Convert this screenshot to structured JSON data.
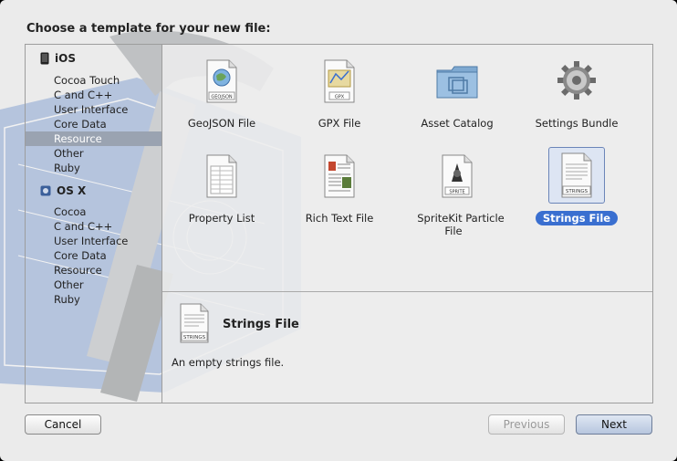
{
  "dialog": {
    "heading": "Choose a template for your new file:"
  },
  "sidebar": {
    "groups": [
      {
        "title": "iOS",
        "icon": "iphone-icon",
        "items": [
          "Cocoa Touch",
          "C and C++",
          "User Interface",
          "Core Data",
          "Resource",
          "Other",
          "Ruby"
        ],
        "selected": "Resource"
      },
      {
        "title": "OS X",
        "icon": "osx-icon",
        "items": [
          "Cocoa",
          "C and C++",
          "User Interface",
          "Core Data",
          "Resource",
          "Other",
          "Ruby"
        ]
      }
    ]
  },
  "templates": [
    {
      "label": "GeoJSON File",
      "icon": "geojson-file-icon",
      "badge": "GEOJSON"
    },
    {
      "label": "GPX File",
      "icon": "gpx-file-icon",
      "badge": "GPX"
    },
    {
      "label": "Asset Catalog",
      "icon": "asset-catalog-folder-icon"
    },
    {
      "label": "Settings Bundle",
      "icon": "settings-gear-icon"
    },
    {
      "label": "Property List",
      "icon": "property-list-icon"
    },
    {
      "label": "Rich Text File",
      "icon": "rich-text-file-icon"
    },
    {
      "label": "SpriteKit Particle File",
      "icon": "sprite-file-icon",
      "badge": "SPRITE"
    },
    {
      "label": "Strings File",
      "icon": "strings-file-icon",
      "badge": "STRINGS",
      "selected": true
    }
  ],
  "detail": {
    "title": "Strings File",
    "description": "An empty strings file.",
    "badge": "STRINGS"
  },
  "buttons": {
    "cancel": "Cancel",
    "previous": "Previous",
    "next": "Next"
  },
  "colors": {
    "selection": "#3a6fd0",
    "sidebar_selection": "#9aa3b1"
  }
}
